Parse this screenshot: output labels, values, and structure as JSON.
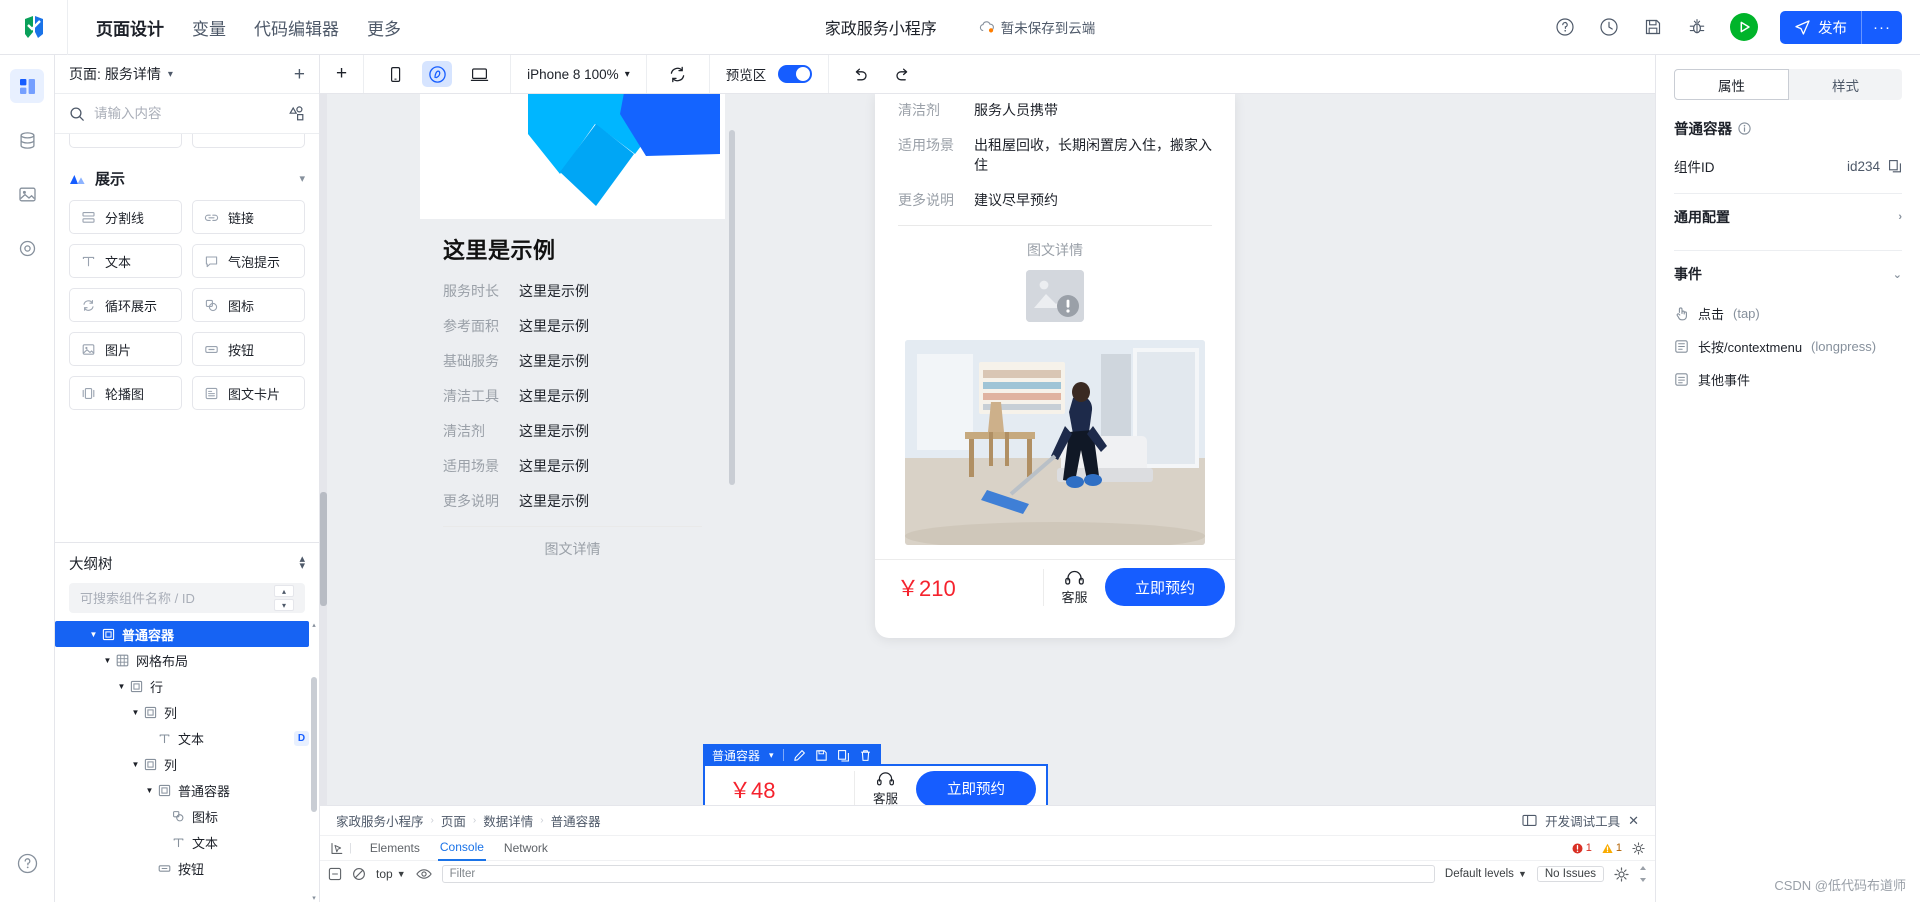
{
  "topbar": {
    "logo_name": "app-logo",
    "menu": [
      {
        "label": "页面设计",
        "active": true
      },
      {
        "label": "变量",
        "active": false
      },
      {
        "label": "代码编辑器",
        "active": false
      },
      {
        "label": "更多",
        "active": false
      }
    ],
    "project_name": "家政服务小程序",
    "cloud_status": "暂未保存到云端",
    "tools": [
      "help-icon",
      "history-icon",
      "save-icon",
      "bug-icon"
    ],
    "run_button": "run-preview-button",
    "publish_label": "发布",
    "publish_more": "···",
    "accent": "#165dff",
    "green": "#00b42a"
  },
  "rail": {
    "items": [
      "components-icon",
      "data-icon",
      "assets-icon",
      "plugins-icon"
    ],
    "help": "help-circle-icon"
  },
  "left_panel": {
    "page_prefix": "页面:",
    "page_name": "服务详情",
    "add_page": "+",
    "search_placeholder": "请输入内容",
    "group_title": "展示",
    "components": [
      {
        "label": "分割线",
        "icon": "divider-icon"
      },
      {
        "label": "链接",
        "icon": "link-icon"
      },
      {
        "label": "文本",
        "icon": "text-icon"
      },
      {
        "label": "气泡提示",
        "icon": "tooltip-icon"
      },
      {
        "label": "循环展示",
        "icon": "loop-icon"
      },
      {
        "label": "图标",
        "icon": "icon-icon"
      },
      {
        "label": "图片",
        "icon": "image-icon"
      },
      {
        "label": "按钮",
        "icon": "button-icon"
      },
      {
        "label": "轮播图",
        "icon": "carousel-icon"
      },
      {
        "label": "图文卡片",
        "icon": "card-icon"
      }
    ],
    "outline": {
      "title": "大纲树",
      "search_placeholder": "可搜索组件名称 / ID",
      "nodes": [
        {
          "label": "普通容器",
          "icon": "container-icon",
          "depth": 2,
          "caret": "▼",
          "selected": true,
          "badge": ""
        },
        {
          "label": "网格布局",
          "icon": "grid-icon",
          "depth": 3,
          "caret": "▼",
          "selected": false,
          "badge": ""
        },
        {
          "label": "行",
          "icon": "container-icon",
          "depth": 4,
          "caret": "▼",
          "selected": false,
          "badge": ""
        },
        {
          "label": "列",
          "icon": "container-icon",
          "depth": 5,
          "caret": "▼",
          "selected": false,
          "badge": ""
        },
        {
          "label": "文本",
          "icon": "text-icon",
          "depth": 6,
          "caret": "",
          "selected": false,
          "badge": "D"
        },
        {
          "label": "列",
          "icon": "container-icon",
          "depth": 5,
          "caret": "▼",
          "selected": false,
          "badge": ""
        },
        {
          "label": "普通容器",
          "icon": "container-icon",
          "depth": 6,
          "caret": "▼",
          "selected": false,
          "badge": ""
        },
        {
          "label": "图标",
          "icon": "icon-icon",
          "depth": 7,
          "caret": "",
          "selected": false,
          "badge": ""
        },
        {
          "label": "文本",
          "icon": "text-icon",
          "depth": 7,
          "caret": "",
          "selected": false,
          "badge": ""
        },
        {
          "label": "按钮",
          "icon": "button-icon",
          "depth": 6,
          "caret": "",
          "selected": false,
          "badge": ""
        }
      ]
    }
  },
  "canvas_toolbar": {
    "add": "+",
    "devices": [
      {
        "name": "mobile-icon",
        "active": false
      },
      {
        "name": "miniprogram-icon",
        "active": true
      },
      {
        "name": "desktop-icon",
        "active": false
      }
    ],
    "device_label": "iPhone 8 100%",
    "refresh": "refresh-icon",
    "preview_label": "预览区",
    "preview_on": true,
    "undo": "undo-icon",
    "redo": "redo-icon"
  },
  "canvas": {
    "selection_toolbar": {
      "name": "普通容器",
      "actions": [
        "edit-icon",
        "save-icon",
        "copy-icon",
        "delete-icon"
      ]
    },
    "phone_left": {
      "title": "这里是示例",
      "rows": [
        {
          "label": "服务时长",
          "value": "这里是示例"
        },
        {
          "label": "参考面积",
          "value": "这里是示例"
        },
        {
          "label": "基础服务",
          "value": "这里是示例"
        },
        {
          "label": "清洁工具",
          "value": "这里是示例"
        },
        {
          "label": "清洁剂",
          "value": "这里是示例"
        },
        {
          "label": "适用场景",
          "value": "这里是示例"
        },
        {
          "label": "更多说明",
          "value": "这里是示例"
        }
      ],
      "section_title": "图文详情",
      "price": "￥48",
      "service_label": "客服",
      "book_label": "立即预约"
    },
    "phone_right": {
      "rows": [
        {
          "label": "清洁剂",
          "value": "服务人员携带"
        },
        {
          "label": "适用场景",
          "value": "出租屋回收，长期闲置房入住，搬家入住"
        },
        {
          "label": "更多说明",
          "value": "建议尽早预约"
        }
      ],
      "section_title": "图文详情",
      "price": "￥210",
      "service_label": "客服",
      "book_label": "立即预约"
    }
  },
  "right_panel": {
    "tabs": [
      {
        "label": "属性",
        "active": true
      },
      {
        "label": "样式",
        "active": false
      }
    ],
    "component_title": "普通容器",
    "component_title_icon": "info-icon",
    "id_label": "组件ID",
    "id_value": "id234",
    "id_copy_icon": "copy-icon",
    "general_config": "通用配置",
    "events_title": "事件",
    "events": [
      {
        "label": "点击",
        "sub": "(tap)",
        "icon": "tap-icon"
      },
      {
        "label": "长按/contextmenu",
        "sub": "(longpress)",
        "icon": "longpress-icon"
      },
      {
        "label": "其他事件",
        "sub": "",
        "icon": "other-icon"
      }
    ]
  },
  "devtools": {
    "breadcrumb": [
      "家政服务小程序",
      "页面",
      "数据详情",
      "普通容器"
    ],
    "devtool_label": "开发调试工具",
    "close": "✕",
    "tabs": [
      {
        "label": "Elements",
        "active": false
      },
      {
        "label": "Console",
        "active": true
      },
      {
        "label": "Network",
        "active": false
      }
    ],
    "error_count": "1",
    "warn_count": "1",
    "context": "top",
    "filter_placeholder": "Filter",
    "levels": "Default levels",
    "issues": "No Issues",
    "eye_icon": "eye-icon",
    "clear_icon": "clear-icon",
    "inspect_icon": "inspect-icon",
    "gear_icon": "settings-icon"
  },
  "watermark": "CSDN @低代码布道师"
}
